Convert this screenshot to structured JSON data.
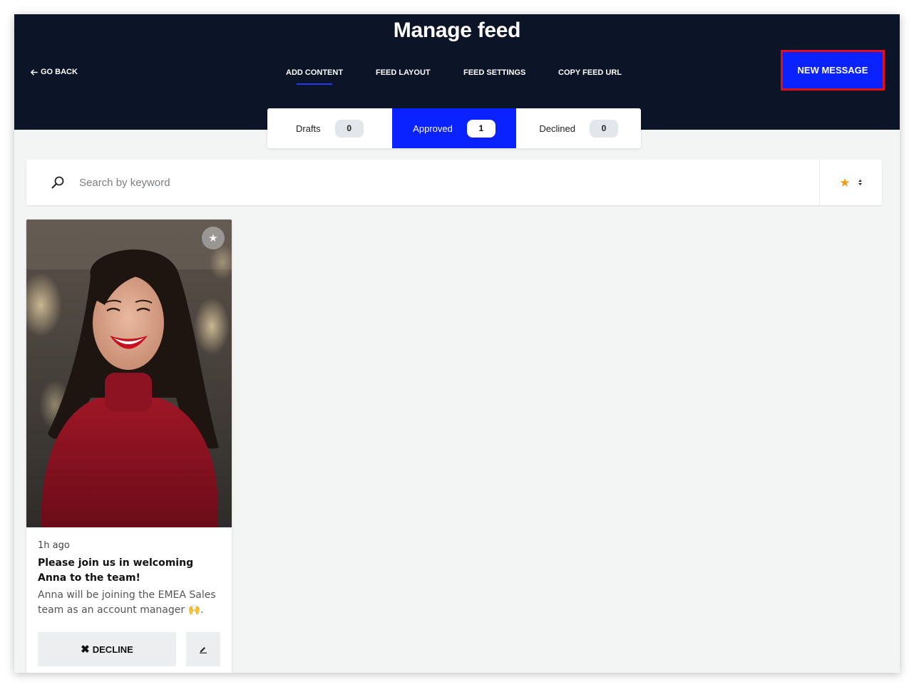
{
  "header": {
    "title": "Manage feed",
    "go_back": "GO BACK",
    "tabs": [
      {
        "label": "ADD CONTENT",
        "active": true
      },
      {
        "label": "FEED LAYOUT",
        "active": false
      },
      {
        "label": "FEED SETTINGS",
        "active": false
      },
      {
        "label": "COPY FEED URL",
        "active": false
      }
    ],
    "new_message": "NEW MESSAGE"
  },
  "status_tabs": [
    {
      "label": "Drafts",
      "count": "0",
      "active": false
    },
    {
      "label": "Approved",
      "count": "1",
      "active": true
    },
    {
      "label": "Declined",
      "count": "0",
      "active": false
    }
  ],
  "search": {
    "placeholder": "Search by keyword",
    "value": "",
    "sort_icon": "star-icon"
  },
  "posts": [
    {
      "time": "1h ago",
      "title": "Please join us in welcoming Anna to the team!",
      "body": "Anna will be joining the EMEA Sales team as an account manager 🙌.",
      "decline_label": "DECLINE",
      "image": "portrait of smiling woman in red sweater"
    }
  ],
  "colors": {
    "header_bg": "#0c1428",
    "accent": "#0a22ff",
    "highlight_border": "#e0101a",
    "page_bg": "#f3f4f4",
    "star": "#f39c12"
  }
}
